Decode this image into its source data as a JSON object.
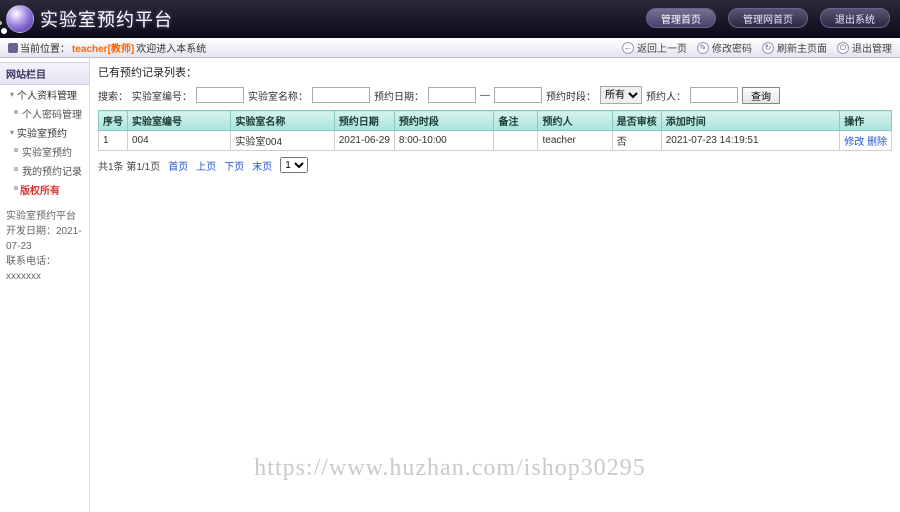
{
  "header": {
    "title": "实验室预约平台",
    "buttons": {
      "admin": "管理首页",
      "front": "管理网首页",
      "logout": "退出系统"
    }
  },
  "crumb": {
    "prefix": "当前位置：",
    "user": "teacher",
    "role": "[教师]",
    "suffix": "欢迎进入本系统"
  },
  "tools": {
    "back": "返回上一页",
    "pwd": "修改密码",
    "refresh": "刷新主页面",
    "logout": "退出管理"
  },
  "sidebar": {
    "title": "网站栏目",
    "g1": "个人资料管理",
    "g1a": "个人密码管理",
    "g2": "实验室预约",
    "g2a": "实验室预约",
    "g2b": "我的预约记录",
    "refresh": "版权所有",
    "f1": "实验室预约平台",
    "f2l": "开发日期：",
    "f2v": "2021-07-23",
    "f3l": "联系电话：",
    "f3v": "xxxxxxx"
  },
  "panel": {
    "title": "已有预约记录列表："
  },
  "search": {
    "l1": "搜索：",
    "l2": "实验室编号：",
    "l3": "实验室名称：",
    "l4": "预约日期：",
    "dash": "—",
    "l5": "预约时段：",
    "opt5": "所有",
    "l6": "预约人：",
    "btn": "查询"
  },
  "table": {
    "h": [
      "序号",
      "实验室编号",
      "实验室名称",
      "预约日期",
      "预约时段",
      "备注",
      "预约人",
      "是否审核",
      "添加时间",
      "操作"
    ],
    "rows": [
      {
        "idx": "1",
        "code": "004",
        "name": "实验室004",
        "date": "2021-06-29",
        "slot": "8:00-10:00",
        "note": "",
        "person": "teacher",
        "audit": "否",
        "added": "2021-07-23 14:19:51",
        "op1": "修改",
        "op2": "删除"
      }
    ]
  },
  "pager": {
    "total": "共1条 第1/1页",
    "first": "首页",
    "prev": "上页",
    "next": "下页",
    "last": "末页"
  },
  "watermark": "https://www.huzhan.com/ishop30295"
}
